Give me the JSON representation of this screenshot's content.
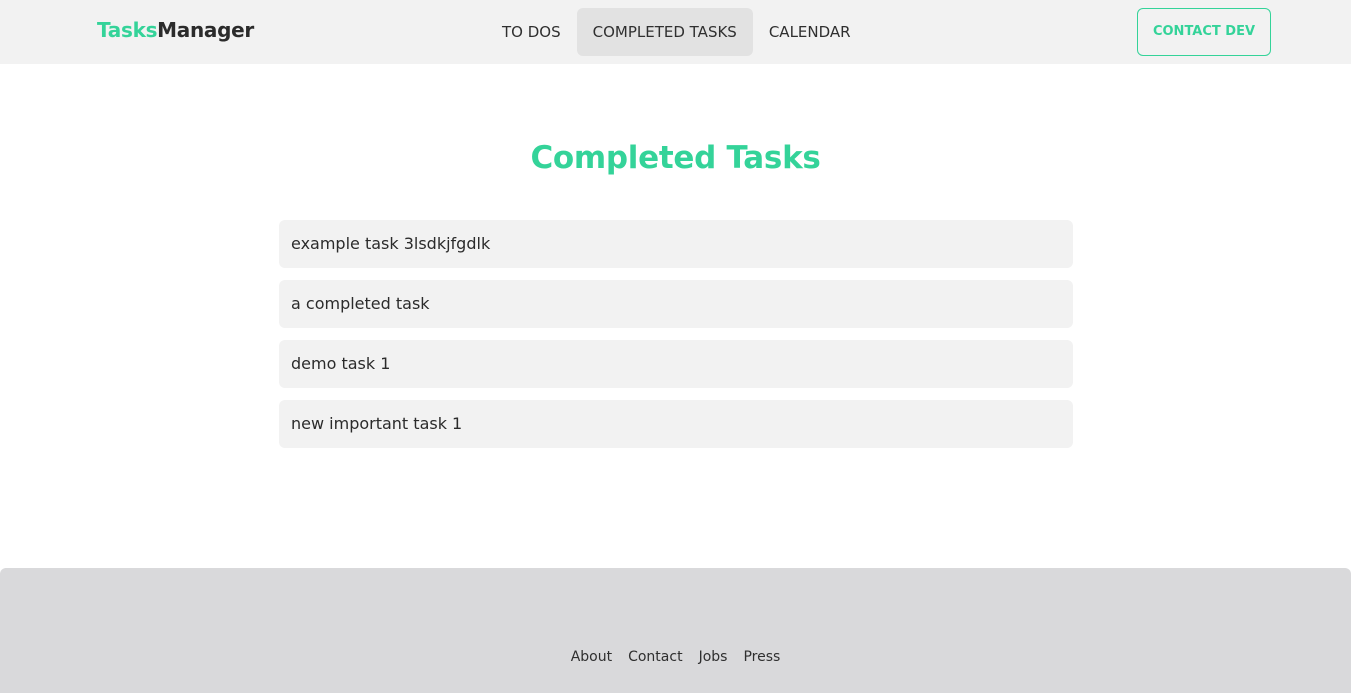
{
  "brand": {
    "part1": "Tasks",
    "part2": "Manager"
  },
  "nav": {
    "items": [
      {
        "label": "TO DOS",
        "active": false
      },
      {
        "label": "COMPLETED TASKS",
        "active": true
      },
      {
        "label": "CALENDAR",
        "active": false
      }
    ],
    "contact_label": "CONTACT DEV"
  },
  "main": {
    "title": "Completed Tasks",
    "tasks": [
      "example task 3lsdkjfgdlk",
      "a completed task",
      "demo task 1",
      "new important task 1"
    ]
  },
  "footer": {
    "links": [
      "About",
      "Contact",
      "Jobs",
      "Press"
    ]
  },
  "colors": {
    "accent": "#34d399",
    "navbar_bg": "#f2f2f2",
    "active_tab_bg": "#e2e2e2",
    "task_bg": "#f2f2f2",
    "footer_bg": "#d9d9db",
    "text": "#2b2b2b"
  }
}
